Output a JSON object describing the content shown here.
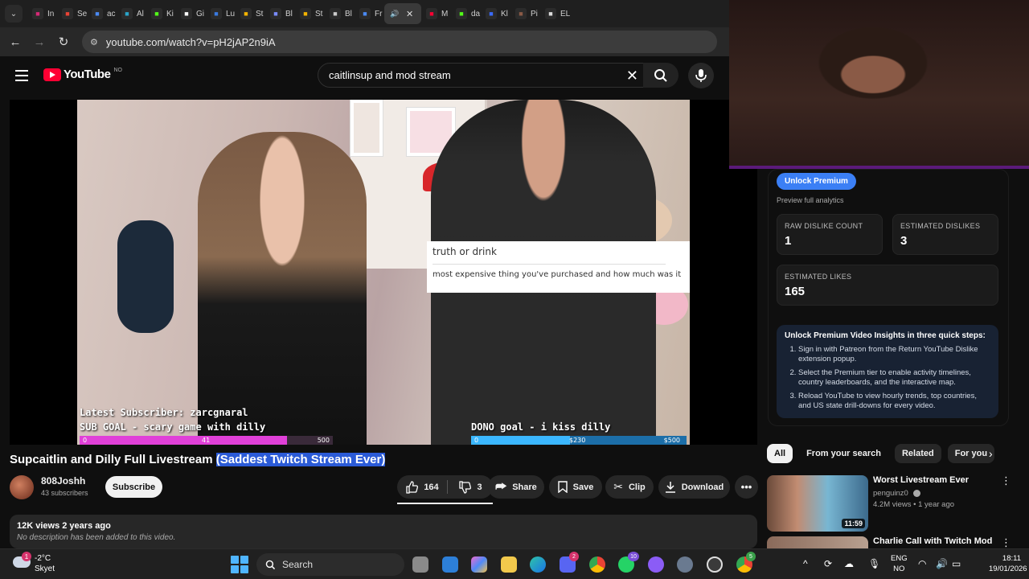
{
  "browser": {
    "tabs": [
      {
        "label": "In",
        "icon": "instagram-icon",
        "color": "#d62976"
      },
      {
        "label": "Se",
        "icon": "gmail-icon",
        "color": "#ea4335"
      },
      {
        "label": "ac",
        "icon": "search-icon",
        "color": "#4a8af4"
      },
      {
        "label": "Al",
        "icon": "app-icon",
        "color": "#2aa4c9"
      },
      {
        "label": "Ki",
        "icon": "kick-icon",
        "color": "#53fc18"
      },
      {
        "label": "Gi",
        "icon": "r-icon",
        "color": "#ffffff"
      },
      {
        "label": "Lu",
        "icon": "lu-icon",
        "color": "#3a7ae0"
      },
      {
        "label": "St",
        "icon": "crown-icon",
        "color": "#f5b400"
      },
      {
        "label": "Bl",
        "icon": "bl-icon",
        "color": "#7a8cff"
      },
      {
        "label": "St",
        "icon": "crown-icon",
        "color": "#f5b400"
      },
      {
        "label": "Bl",
        "icon": "openai-icon",
        "color": "#cccccc"
      },
      {
        "label": "Fr",
        "icon": "doc-icon",
        "color": "#4a8af4"
      },
      {
        "label": "",
        "icon": "speaker-icon",
        "color": "#dddddd",
        "active": true
      },
      {
        "label": "M",
        "icon": "youtube-icon",
        "color": "#ff0033"
      },
      {
        "label": "da",
        "icon": "kick-icon",
        "color": "#53fc18"
      },
      {
        "label": "Kl",
        "icon": "k-icon",
        "color": "#3b6bff"
      },
      {
        "label": "Pi",
        "icon": "pi-icon",
        "color": "#8a5a46"
      },
      {
        "label": "EL",
        "icon": "el-icon",
        "color": "#dddddd"
      }
    ],
    "url": "youtube.com/watch?v=pH2jAP2n9iA"
  },
  "youtube": {
    "logo_text": "YouTube",
    "country_code": "NO",
    "search_query": "caitlinsup and mod stream"
  },
  "video": {
    "overlay_card_title": "truth or drink",
    "overlay_card_question": "most expensive thing you've purchased and how much was it",
    "latest_subscriber": "Latest Subscriber: zarcgnaral",
    "sub_goal": "SUB GOAL - scary game with dilly",
    "sub_goal_bar": {
      "start": "0",
      "current": "41",
      "target": "500",
      "progress": 0.82
    },
    "dono_goal": "DONO goal - i kiss dilly",
    "dono_goal_bar": {
      "start": "0",
      "current": "$230",
      "target": "$500",
      "progress": 0.46
    }
  },
  "meta": {
    "title_plain": "Supcaitlin and Dilly Full Livestream ",
    "title_highlight": "(Saddest Twitch Stream Ever)",
    "channel_name": "808Joshh",
    "subscribers": "43 subscribers",
    "subscribe_label": "Subscribe",
    "likes": "164",
    "dislikes": "3",
    "share_label": "Share",
    "save_label": "Save",
    "clip_label": "Clip",
    "download_label": "Download",
    "views_date": "12K views  2 years ago",
    "description": "No description has been added to this video."
  },
  "dislike_panel": {
    "premium_button": "Unlock Premium",
    "subtitle": "Preview full analytics",
    "raw_dislike_label": "RAW DISLIKE COUNT",
    "raw_dislike_value": "1",
    "est_dislike_label": "ESTIMATED DISLIKES",
    "est_dislike_value": "3",
    "est_likes_label": "ESTIMATED LIKES",
    "est_likes_value": "165",
    "steps_title": "Unlock Premium Video Insights in three quick steps:",
    "steps": [
      "Sign in with Patreon from the Return YouTube Dislike extension popup.",
      "Select the Premium tier to enable activity timelines, country leaderboards, and the interactive map.",
      "Reload YouTube to view hourly trends, top countries, and US state drill-downs for every video."
    ]
  },
  "chips": [
    "All",
    "From your search",
    "Related",
    "For you"
  ],
  "recommendations": [
    {
      "title": "Worst Livestream Ever",
      "channel": "penguinz0",
      "meta": "4.2M views • 1 year ago",
      "duration": "11:59"
    },
    {
      "title": "Charlie Call with Twitch Mod"
    }
  ],
  "taskbar": {
    "weather_temp": "-2°C",
    "weather_desc": "Skyet",
    "weather_badge": "1",
    "search_label": "Search",
    "discord_badge": "2",
    "whatsapp_badge": "10",
    "chrome_badge": "5",
    "lang_top": "ENG",
    "lang_bottom": "NO",
    "time": "18:11",
    "date": "19/01/2026"
  }
}
